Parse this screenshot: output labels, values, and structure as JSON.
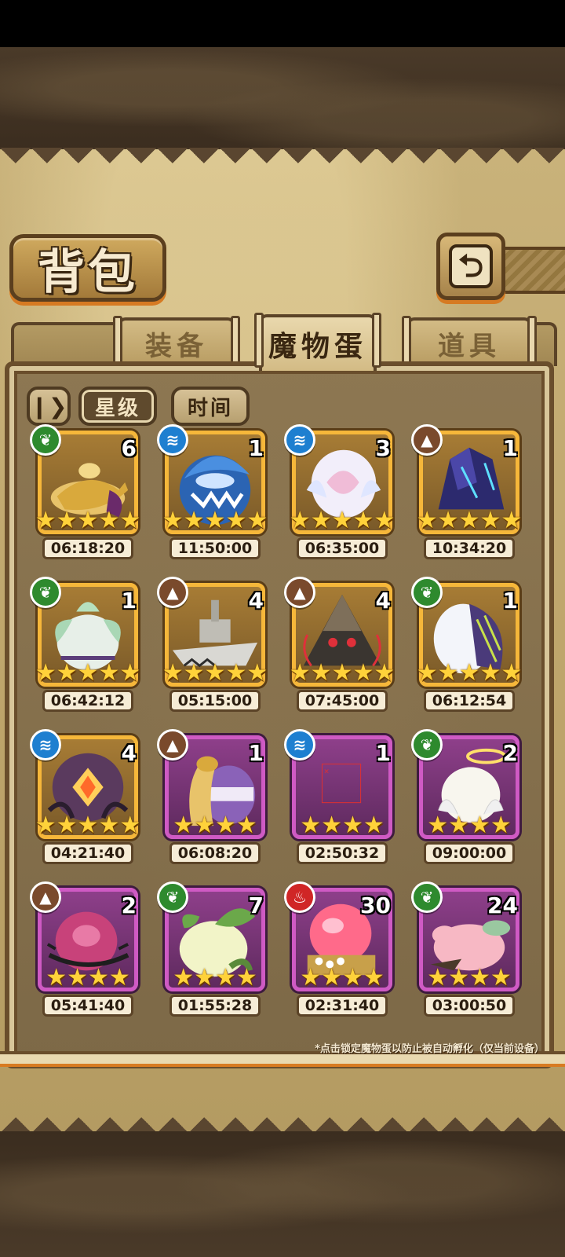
{
  "header": {
    "title": "背包",
    "back_icon": "back-arrow-icon"
  },
  "tabs": [
    {
      "label": "装备",
      "active": false
    },
    {
      "label": "魔物蛋",
      "active": true
    },
    {
      "label": "道具",
      "active": false
    }
  ],
  "toolbar": {
    "pause_icon": "pause-icon",
    "sort_star_label": "星级",
    "sort_time_label": "时间",
    "active_sort": "星级"
  },
  "eggs": [
    {
      "name": "lamp-egg",
      "element": "grass",
      "count": "6",
      "stars": 5,
      "time": "06:18:20",
      "rarity": "gold"
    },
    {
      "name": "shark-egg",
      "element": "water",
      "count": "1",
      "stars": 5,
      "time": "11:50:00",
      "rarity": "gold"
    },
    {
      "name": "pearl-egg",
      "element": "water",
      "count": "3",
      "stars": 5,
      "time": "06:35:00",
      "rarity": "gold"
    },
    {
      "name": "crystal-egg",
      "element": "earth",
      "count": "1",
      "stars": 5,
      "time": "10:34:20",
      "rarity": "gold"
    },
    {
      "name": "leaf-egg",
      "element": "grass",
      "count": "1",
      "stars": 5,
      "time": "06:42:12",
      "rarity": "gold"
    },
    {
      "name": "battleship-egg",
      "element": "earth",
      "count": "4",
      "stars": 5,
      "time": "05:15:00",
      "rarity": "gold"
    },
    {
      "name": "pyramid-egg",
      "element": "earth",
      "count": "4",
      "stars": 5,
      "time": "07:45:00",
      "rarity": "gold"
    },
    {
      "name": "wing-egg",
      "element": "grass",
      "count": "1",
      "stars": 5,
      "time": "06:12:54",
      "rarity": "gold"
    },
    {
      "name": "eye-egg",
      "element": "water",
      "count": "4",
      "stars": 5,
      "time": "04:21:40",
      "rarity": "gold"
    },
    {
      "name": "cobra-egg",
      "element": "earth",
      "count": "1",
      "stars": 4,
      "time": "06:08:20",
      "rarity": "purple"
    },
    {
      "name": "missing-egg",
      "element": "water",
      "count": "1",
      "stars": 4,
      "time": "02:50:32",
      "rarity": "purple"
    },
    {
      "name": "halo-egg",
      "element": "grass",
      "count": "2",
      "stars": 4,
      "time": "09:00:00",
      "rarity": "purple"
    },
    {
      "name": "thorn-egg",
      "element": "earth",
      "count": "2",
      "stars": 4,
      "time": "05:41:40",
      "rarity": "purple"
    },
    {
      "name": "sprout-egg",
      "element": "grass",
      "count": "7",
      "stars": 4,
      "time": "01:55:28",
      "rarity": "purple"
    },
    {
      "name": "treasure-egg",
      "element": "fire",
      "count": "30",
      "stars": 4,
      "time": "02:31:40",
      "rarity": "purple"
    },
    {
      "name": "pig-egg",
      "element": "grass",
      "count": "24",
      "stars": 4,
      "time": "03:00:50",
      "rarity": "purple"
    }
  ],
  "footnote": "*点击锁定魔物蛋以防止被自动孵化（仅当前设备）",
  "colors": {
    "gold_frame": "#f6b73a",
    "purple_frame": "#cf5ac4",
    "grass": "#2e8a2e",
    "water": "#1e7fd0",
    "earth": "#7a4a2c",
    "fire": "#d02626"
  }
}
